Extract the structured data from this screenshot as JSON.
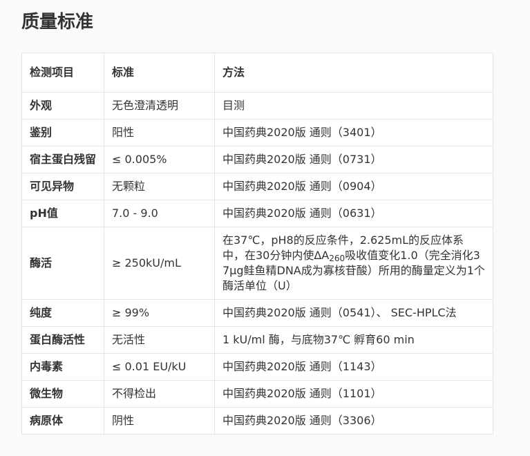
{
  "page": {
    "title": "质量标准"
  },
  "table": {
    "headers": [
      "检测项目",
      "标准",
      "方法"
    ],
    "rows": [
      {
        "item": "外观",
        "standard": "无色澄清透明",
        "method": "目测"
      },
      {
        "item": "鉴别",
        "standard": "阳性",
        "method": "中国药典2020版 通则（3401）"
      },
      {
        "item": "宿主蛋白残留",
        "standard": "≤ 0.005%",
        "method": "中国药典2020版 通则（0731）"
      },
      {
        "item": "可见异物",
        "standard": "无颗粒",
        "method": "中国药典2020版 通则（0904）"
      },
      {
        "item": "pH值",
        "standard": "7.0 - 9.0",
        "method": "中国药典2020版 通则（0631）"
      },
      {
        "item": "酶活",
        "standard": "≥ 250kU/mL",
        "method_parts": [
          "在37℃，pH8的反应条件，2.625mL的反应体系中，在30分钟内使ΔA",
          "260",
          "吸收值变化1.0（完全消化37μg鲑鱼精DNA成为寡核苷酸）所用的酶量定义为1个酶活单位（U）"
        ]
      },
      {
        "item": "纯度",
        "standard": "≥ 99%",
        "method": "中国药典2020版 通则（0541）、 SEC-HPLC法"
      },
      {
        "item": "蛋白酶活性",
        "standard": "无活性",
        "method": "1 kU/ml 酶，与底物37℃ 孵育60 min"
      },
      {
        "item": "内毒素",
        "standard": "≤ 0.01 EU/kU",
        "method": "中国药典2020版 通则（1143）"
      },
      {
        "item": "微生物",
        "standard": "不得检出",
        "method": "中国药典2020版 通则（1101）"
      },
      {
        "item": "病原体",
        "standard": "阴性",
        "method": "中国药典2020版 通则（3306）"
      }
    ]
  }
}
